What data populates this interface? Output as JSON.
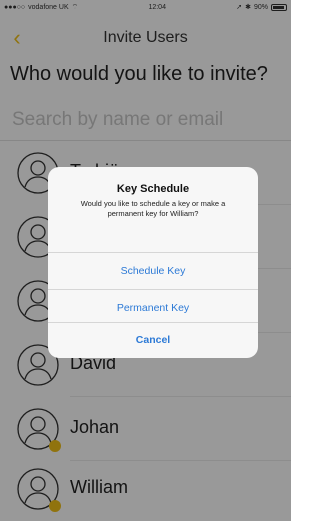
{
  "status_bar": {
    "carrier": "vodafone UK",
    "time": "12:04",
    "battery": "90%",
    "battery_level": 0.9
  },
  "nav": {
    "back_icon": "chevron-left-icon",
    "title": "Invite Users"
  },
  "question": "Who would you like to invite?",
  "search": {
    "placeholder": "Search by name or email",
    "value": ""
  },
  "contacts": [
    {
      "name": "Torbjörn",
      "badge": false
    },
    {
      "name": "",
      "badge": false
    },
    {
      "name": "",
      "badge": false
    },
    {
      "name": "David",
      "badge": false
    },
    {
      "name": "Johan",
      "badge": true
    },
    {
      "name": "William",
      "badge": true
    }
  ],
  "alert": {
    "title": "Key Schedule",
    "message": "Would you like to schedule a key or make a permanent key for William?",
    "schedule_label": "Schedule Key",
    "permanent_label": "Permanent Key",
    "cancel_label": "Cancel"
  },
  "colors": {
    "accent": "#f0c018",
    "alert_button": "#2d7ad6"
  }
}
